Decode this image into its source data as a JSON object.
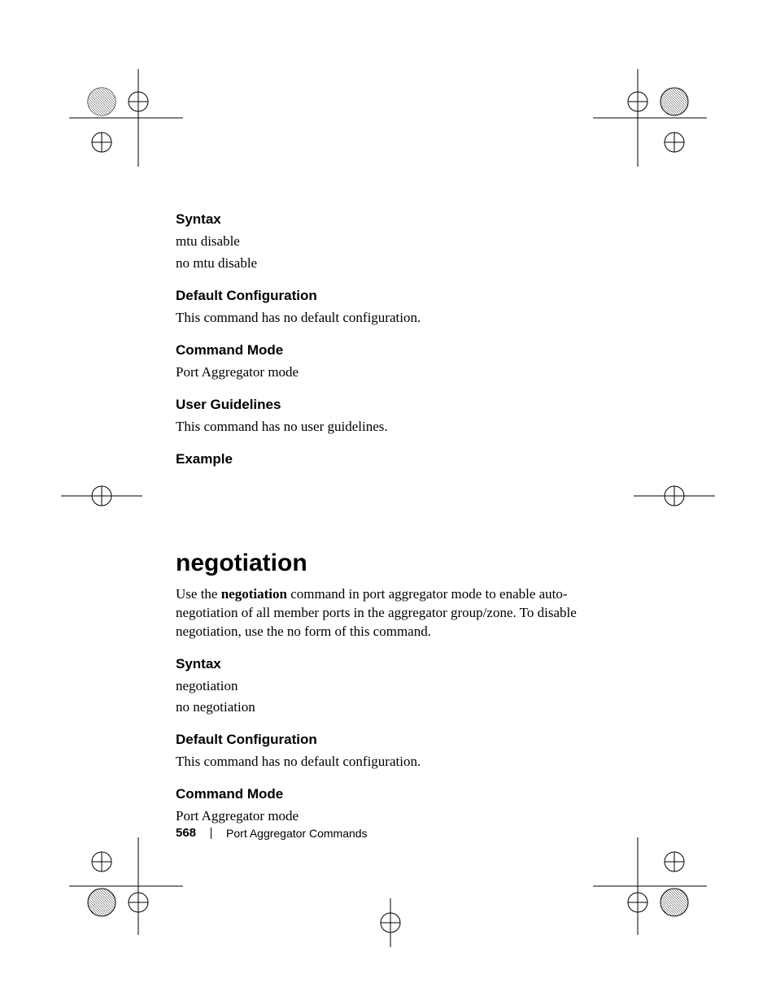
{
  "sections1": {
    "syntax": {
      "heading": "Syntax",
      "line1": "mtu disable",
      "line2": "no mtu disable"
    },
    "default_config": {
      "heading": "Default Configuration",
      "text": "This command has no default configuration."
    },
    "command_mode": {
      "heading": "Command Mode",
      "text": "Port Aggregator mode"
    },
    "user_guidelines": {
      "heading": "User Guidelines",
      "text": "This command has no user guidelines."
    },
    "example": {
      "heading": "Example"
    }
  },
  "command2": {
    "title": "negotiation",
    "intro_pre": "Use the ",
    "intro_bold": "negotiation",
    "intro_post": " command in port aggregator mode to enable auto-negotiation of all member ports in the aggregator group/zone. To disable negotiation, use the no form of this command.",
    "syntax": {
      "heading": "Syntax",
      "line1": "negotiation",
      "line2": "no negotiation"
    },
    "default_config": {
      "heading": "Default Configuration",
      "text": "This command has no default configuration."
    },
    "command_mode": {
      "heading": "Command Mode",
      "text": "Port Aggregator mode"
    }
  },
  "footer": {
    "page_number": "568",
    "chapter": "Port Aggregator Commands"
  }
}
